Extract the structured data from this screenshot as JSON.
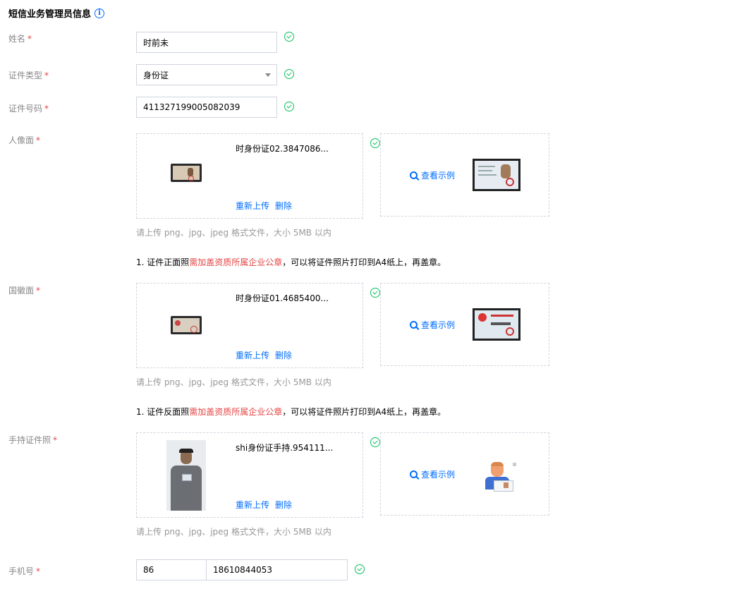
{
  "section": {
    "title": "短信业务管理员信息"
  },
  "fields": {
    "name": {
      "label": "姓名",
      "value": "时前未"
    },
    "id_type": {
      "label": "证件类型",
      "value": "身份证"
    },
    "id_number": {
      "label": "证件号码",
      "value": "411327199005082039"
    },
    "portrait": {
      "label": "人像面",
      "file_name": "时身份证02.3847086..."
    },
    "emblem": {
      "label": "国徽面",
      "file_name": "时身份证01.4685400..."
    },
    "handheld": {
      "label": "手持证件照",
      "file_name": "shi身份证手持.954111..."
    },
    "phone": {
      "label": "手机号",
      "country_code": "86",
      "number": "18610844053"
    }
  },
  "actions": {
    "reupload": "重新上传",
    "delete": "删除",
    "view_example": "查看示例"
  },
  "upload_hint": "请上传 png、jpg、jpeg 格式文件，大小 5MB 以内",
  "notes": {
    "front": {
      "prefix": "1. 证件正面照",
      "highlight": "需加盖资质所属企业公章",
      "suffix": "，可以将证件照片打印到A4纸上，再盖章。"
    },
    "back": {
      "prefix": "1. 证件反面照",
      "highlight": "需加盖资质所属企业公章",
      "suffix": "，可以将证件照片打印到A4纸上，再盖章。"
    }
  },
  "colors": {
    "accent": "#006eff",
    "success": "#0abf5b",
    "required": "#e54545"
  }
}
